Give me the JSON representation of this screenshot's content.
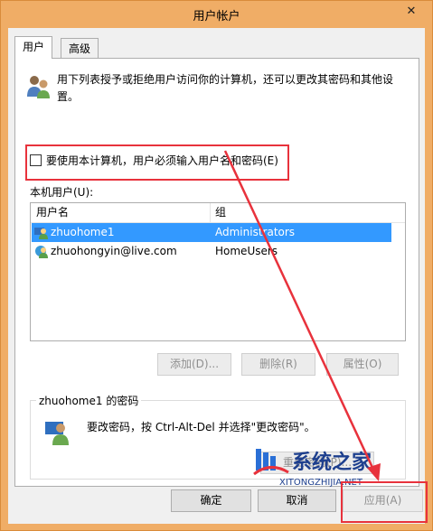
{
  "window": {
    "title": "用户帐户",
    "close_glyph": "✕"
  },
  "tabs": [
    {
      "label": "用户",
      "active": true
    },
    {
      "label": "高级",
      "active": false
    }
  ],
  "description": "用下列表授予或拒绝用户访问你的计算机，还可以更改其密码和其他设置。",
  "require_login": {
    "label": "要使用本计算机，用户必须输入用户名和密码(E)",
    "checked": false
  },
  "users_list": {
    "label": "本机用户(U):",
    "columns": [
      "用户名",
      "组"
    ],
    "rows": [
      {
        "name": "zhuohome1",
        "group": "Administrators",
        "selected": true
      },
      {
        "name": "zhuohongyin@live.com",
        "group": "HomeUsers",
        "selected": false
      }
    ]
  },
  "list_buttons": {
    "add": "添加(D)...",
    "remove": "删除(R)",
    "properties": "属性(O)"
  },
  "password_group": {
    "title": "zhuohome1 的密码",
    "instruction": "要改密码，按 Ctrl-Alt-Del 并选择\"更改密码\"。",
    "reset_button": "重置密码(P)..."
  },
  "dialog_buttons": {
    "ok": "确定",
    "cancel": "取消",
    "apply": "应用(A)"
  },
  "watermark": {
    "name": "系统之家",
    "url": "XITONGZHIJIA.NET"
  },
  "colors": {
    "accent_frame": "#f0ad66",
    "selection": "#3399ff",
    "annotation_red": "#e8323c",
    "watermark_blue": "#1d3f8e"
  }
}
